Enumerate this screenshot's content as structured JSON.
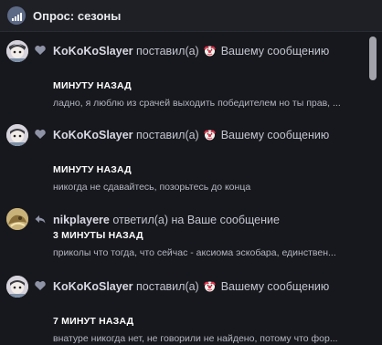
{
  "header": {
    "title": "Опрос: сезоны",
    "icon": "poll-icon"
  },
  "notifications": [
    {
      "user": "KoKoKoSlayer",
      "action": "поставил(а)",
      "reaction_icon": "clown-emoji-icon",
      "action_tail": "Вашему сообщению",
      "type_icon": "heart-icon",
      "time": "МИНУТУ НАЗАД",
      "excerpt": "ладно, я люблю из срачей выходить победителем но ты прав, ..."
    },
    {
      "user": "KoKoKoSlayer",
      "action": "поставил(а)",
      "reaction_icon": "clown-emoji-icon",
      "action_tail": "Вашему сообщению",
      "type_icon": "heart-icon",
      "time": "МИНУТУ НАЗАД",
      "excerpt": "никогда не сдавайтесь, позорьтесь до конца"
    },
    {
      "user": "nikplayere",
      "action": "ответил(а) на Ваше сообщение",
      "type_icon": "reply-icon",
      "time": "3 МИНУТЫ НАЗАД",
      "excerpt": "приколы что тогда, что сейчас - аксиома эскобара, единствен..."
    },
    {
      "user": "KoKoKoSlayer",
      "action": "поставил(а)",
      "reaction_icon": "clown-emoji-icon",
      "action_tail": "Вашему сообщению",
      "type_icon": "heart-icon",
      "time": "7 МИНУТ НАЗАД",
      "excerpt": "внатуре никогда нет, не говорили не найдено, потому что фор..."
    }
  ],
  "colors": {
    "background": "#17181d",
    "header": "#1f2026",
    "text": "#c3c5d0",
    "time": "#ffffff",
    "icon": "#8f93a6"
  }
}
